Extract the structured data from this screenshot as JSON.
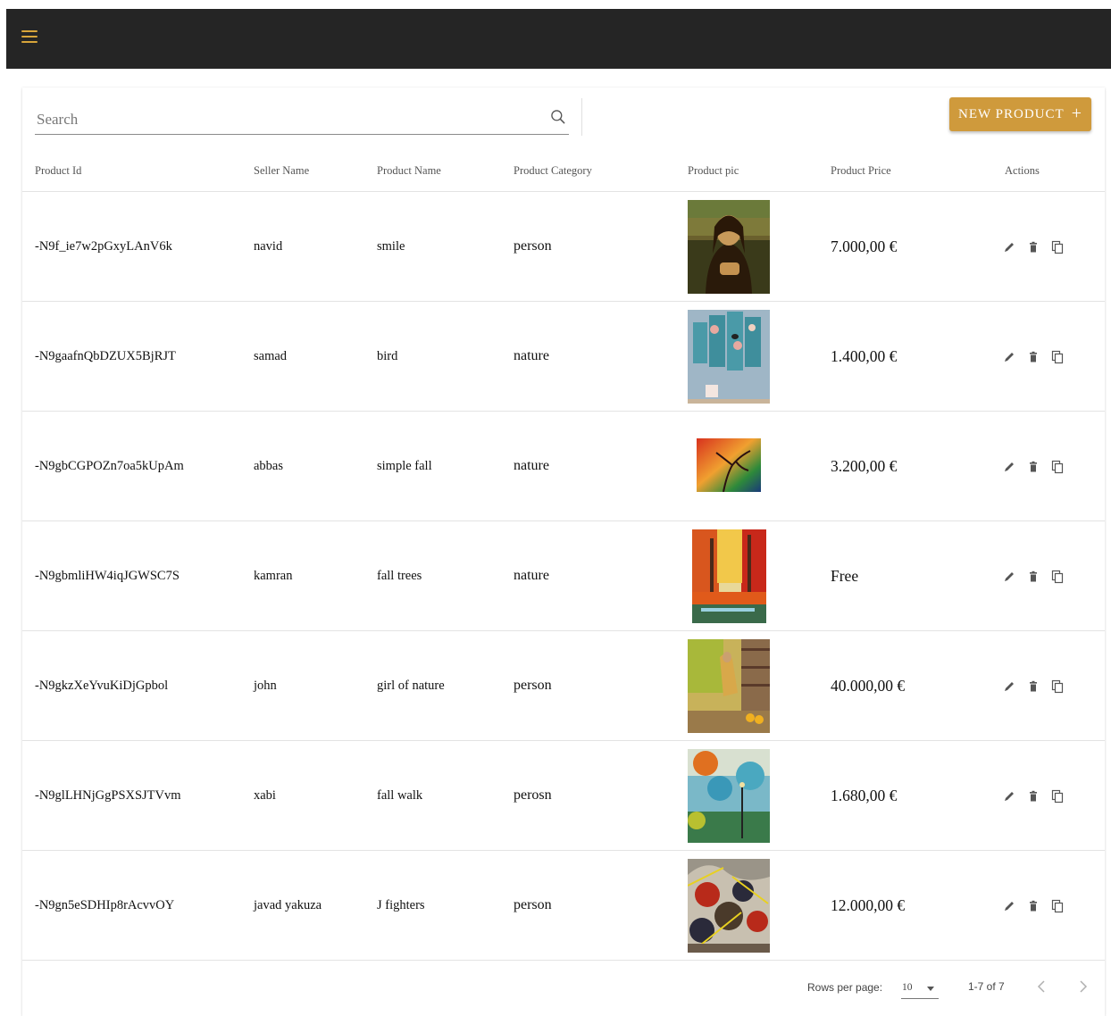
{
  "appbar": {
    "menu_icon": "menu-icon",
    "accent": "#d8a53a",
    "background": "#252525"
  },
  "toolbar": {
    "search_placeholder": "Search",
    "search_icon": "search-icon",
    "new_button_label": "New Product",
    "new_button_icon": "plus-icon",
    "button_color": "#cf9a3c"
  },
  "table": {
    "headers": [
      "Product Id",
      "Seller Name",
      "Product Name",
      "Product Category",
      "Product pic",
      "Product Price",
      "Actions"
    ],
    "rows": [
      {
        "id": "-N9f_ie7w2pGxyLAnV6k",
        "seller": "navid",
        "name": "smile",
        "category": "person",
        "pic": "mona-lisa-painting",
        "price": "7.000,00 €"
      },
      {
        "id": "-N9gaafnQbDZUX5BjRJT",
        "seller": "samad",
        "name": "bird",
        "category": "nature",
        "pic": "bird-panels-painting",
        "price": "1.400,00 €"
      },
      {
        "id": "-N9gbCGPOZn7oa5kUpAm",
        "seller": "abbas",
        "name": "simple fall",
        "category": "nature",
        "pic": "autumn-tree-painting",
        "price": "3.200,00 €"
      },
      {
        "id": "-N9gbmliHW4iqJGWSC7S",
        "seller": "kamran",
        "name": "fall trees",
        "category": "nature",
        "pic": "fall-trees-painting",
        "price": "Free"
      },
      {
        "id": "-N9gkzXeYvuKiDjGpbol",
        "seller": "john",
        "name": "girl of nature",
        "category": "person",
        "pic": "girl-on-porch-painting",
        "price": "40.000,00 €"
      },
      {
        "id": "-N9glLHNjGgPSXSJTVvm",
        "seller": "xabi",
        "name": "fall walk",
        "category": "perosn",
        "pic": "fall-walk-painting",
        "price": "1.680,00 €"
      },
      {
        "id": "-N9gn5eSDHIp8rAcvvOY",
        "seller": "javad yakuza",
        "name": "J fighters",
        "category": "person",
        "pic": "japanese-fighters-painting",
        "price": "12.000,00 €"
      }
    ],
    "action_icons": [
      "edit-icon",
      "delete-icon",
      "copy-icon"
    ]
  },
  "pagination": {
    "rows_per_page_label": "Rows per page:",
    "rows_per_page_value": "10",
    "range_label": "1-7 of 7",
    "prev_icon": "chevron-left-icon",
    "next_icon": "chevron-right-icon"
  }
}
